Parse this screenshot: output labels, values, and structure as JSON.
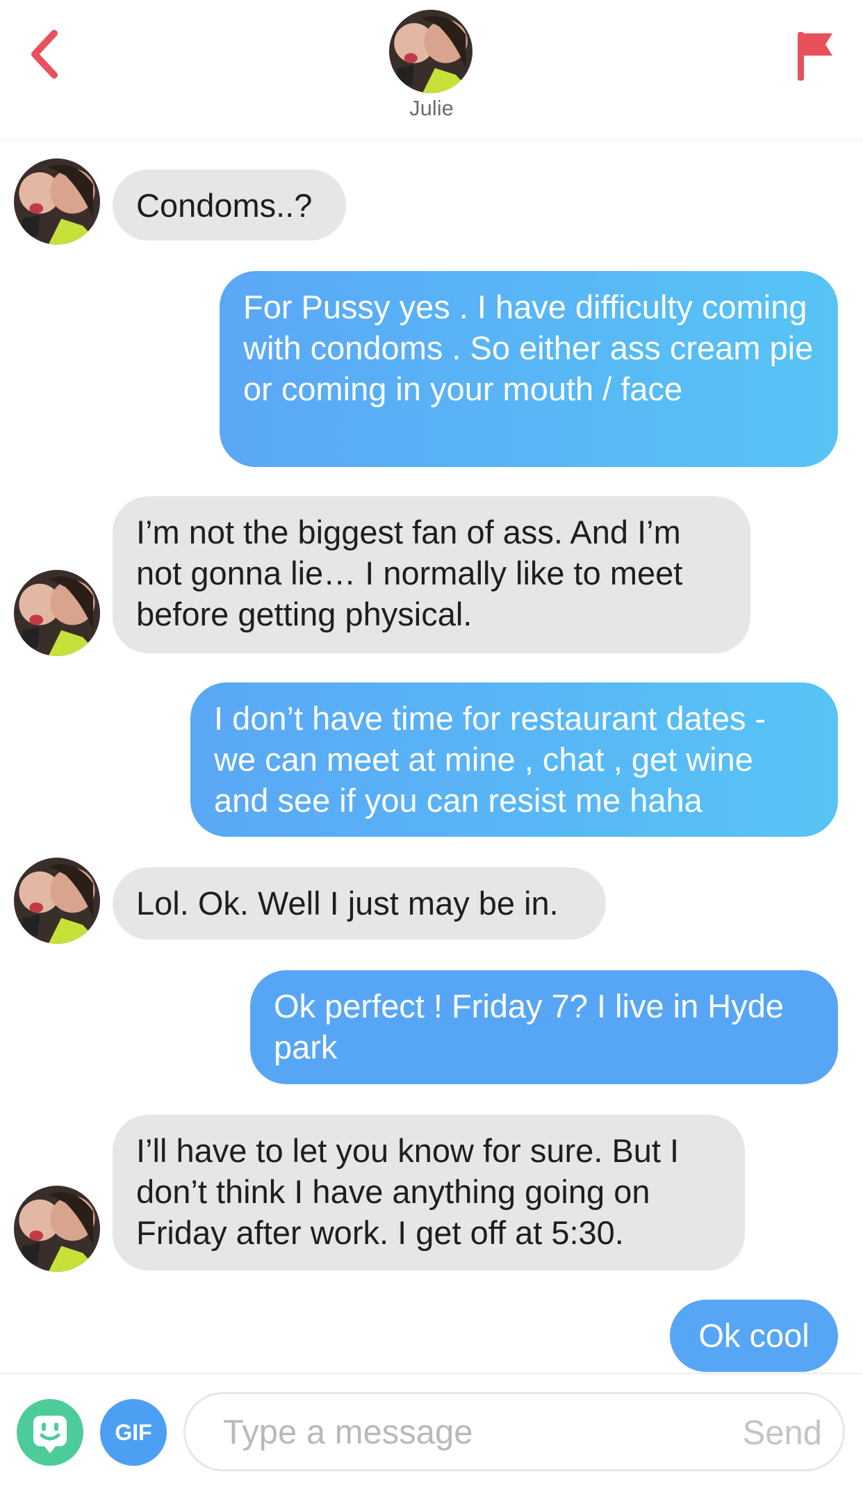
{
  "header": {
    "back_icon": "chevron-left-icon",
    "flag_icon": "flag-icon",
    "contact_name": "Julie",
    "accent_color": "#e8505b"
  },
  "messages": [
    {
      "from": "them",
      "text": "Condoms..?"
    },
    {
      "from": "me",
      "text": "For Pussy yes . I have difficulty coming with condoms . So either ass cream pie or coming in your mouth / face"
    },
    {
      "from": "them",
      "text": "I’m not the biggest fan of ass. And I’m not gonna lie… I normally like to meet before getting physical."
    },
    {
      "from": "me",
      "text": "I don’t have time for restaurant dates - we can meet at mine , chat , get wine and see if you can resist me haha"
    },
    {
      "from": "them",
      "text": "Lol. Ok. Well I just may be in."
    },
    {
      "from": "me",
      "text": "Ok perfect ! Friday 7? I live in Hyde park"
    },
    {
      "from": "them",
      "text": "I’ll have to let you know for sure. But I don’t think I have anything going on Friday after work. I get off at 5:30."
    },
    {
      "from": "me",
      "text": "Ok cool"
    }
  ],
  "composer": {
    "sticker_icon": "sticker-face-icon",
    "gif_label": "GIF",
    "placeholder": "Type a message",
    "value": "",
    "send_label": "Send"
  },
  "colors": {
    "incoming_bubble": "#e6e6e6",
    "outgoing_bubble": "#57b3f6",
    "sticker_button": "#4dcc9b",
    "gif_button": "#4c9ff2"
  }
}
